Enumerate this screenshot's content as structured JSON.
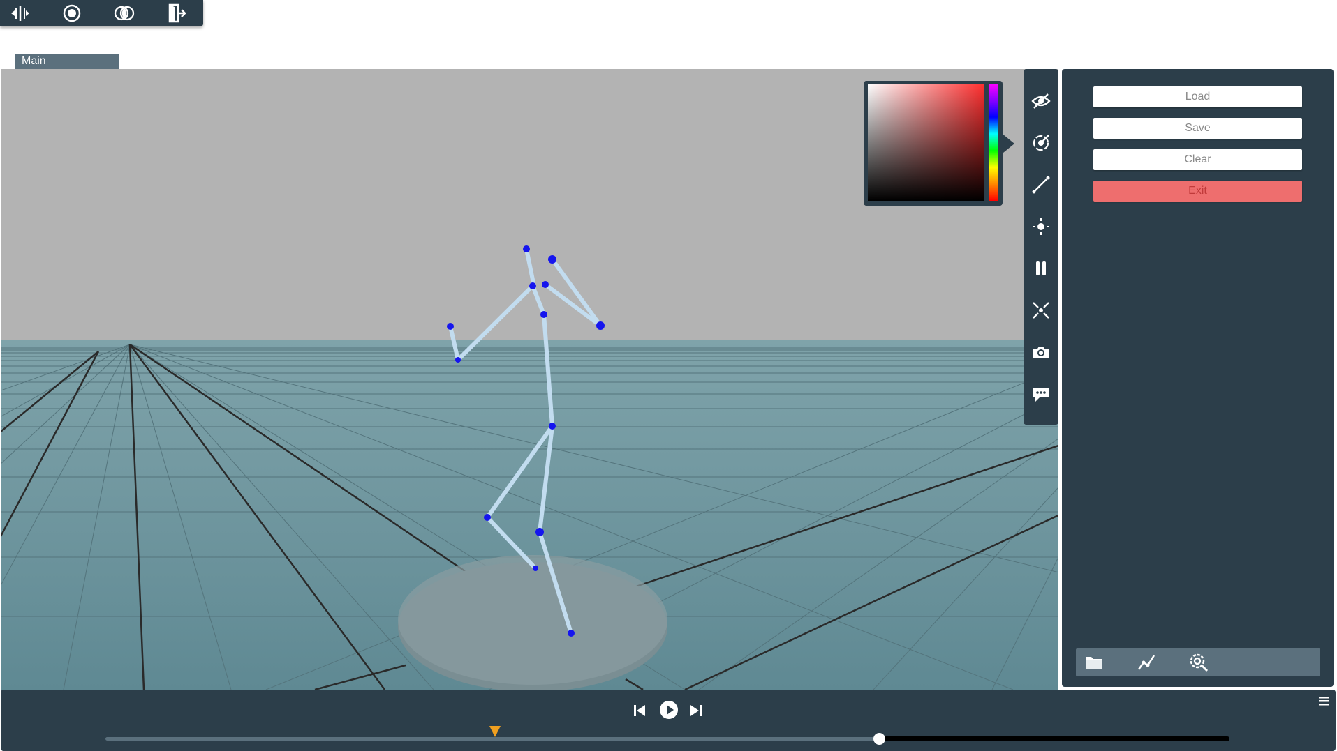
{
  "top_toolbar": {
    "icons": [
      "split-view-icon",
      "record-icon",
      "blend-icon",
      "exit-door-icon"
    ]
  },
  "tab": {
    "label": "Main"
  },
  "right_panel": {
    "load_label": "Load",
    "save_label": "Save",
    "clear_label": "Clear",
    "exit_label": "Exit",
    "bottom_icons": [
      "folder-icon",
      "graph-icon",
      "settings-search-icon"
    ]
  },
  "icon_strip": [
    "eye-off-icon",
    "target-icon",
    "line-tool-icon",
    "light-icon",
    "pause-icon",
    "scatter-icon",
    "camera-icon",
    "chat-icon"
  ],
  "timeline": {
    "icons": [
      "skip-back-icon",
      "play-icon",
      "skip-forward-icon",
      "menu-icon"
    ],
    "position_fraction": 0.685,
    "marker_fraction": 0.34
  },
  "colors": {
    "panel": "#2c3e4a",
    "tab": "#5b707d",
    "exit": "#ee6e6e",
    "bone": "#c2dcef",
    "joint": "#1515ee",
    "marker": "#f0a020"
  }
}
